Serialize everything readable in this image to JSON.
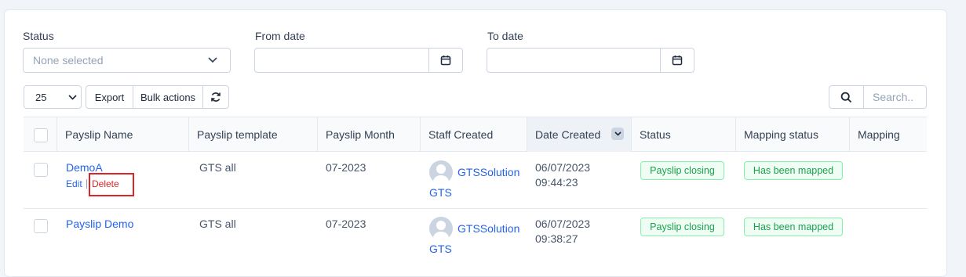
{
  "filters": {
    "status_label": "Status",
    "status_placeholder": "None selected",
    "from_label": "From date",
    "to_label": "To date"
  },
  "toolbar": {
    "page_size": "25",
    "export_label": "Export",
    "bulk_label": "Bulk actions",
    "search_placeholder": "Search.."
  },
  "table": {
    "headers": [
      "Payslip Name",
      "Payslip template",
      "Payslip Month",
      "Staff Created",
      "Date Created",
      "Status",
      "Mapping status",
      "Mapping"
    ],
    "rows": [
      {
        "name": "DemoA",
        "edit": "Edit",
        "delete": "Delete",
        "template": "GTS all",
        "month": "07-2023",
        "staff_1": "GTSSolution",
        "staff_2": "GTS",
        "date": "06/07/2023",
        "time": "09:44:23",
        "status": "Payslip closing",
        "mapping_status": "Has been mapped"
      },
      {
        "name": "Payslip Demo",
        "template": "GTS all",
        "month": "07-2023",
        "staff_1": "GTSSolution",
        "staff_2": "GTS",
        "date": "06/07/2023",
        "time": "09:38:27",
        "status": "Payslip closing",
        "mapping_status": "Has been mapped"
      }
    ]
  },
  "colors": {
    "link": "#2563eb",
    "badge_green": "#16a34a",
    "highlight_red": "#dc2626"
  },
  "icons": [
    "chevron-down-icon",
    "calendar-icon",
    "refresh-icon",
    "search-icon",
    "sort-icon"
  ]
}
